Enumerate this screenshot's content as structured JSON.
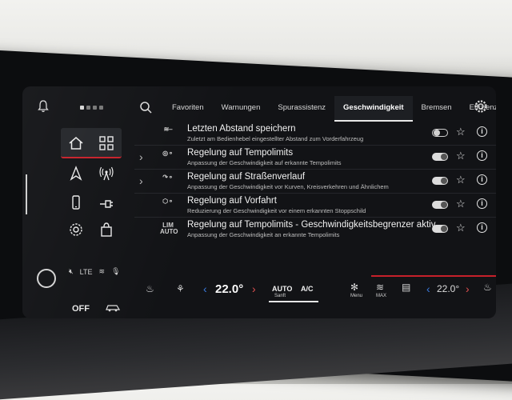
{
  "tabs": [
    {
      "label": "Favoriten"
    },
    {
      "label": "Warnungen"
    },
    {
      "label": "Spurassistenz"
    },
    {
      "label": "Geschwindigkeit"
    },
    {
      "label": "Bremsen"
    },
    {
      "label": "Effizienz"
    }
  ],
  "active_tab": "Geschwindigkeit",
  "rows": [
    {
      "title": "Letzten Abstand speichern",
      "subtitle": "Zuletzt am Bedienhebel eingestellter Abstand zum Vorderfahrzeug",
      "icon": "distance-icon",
      "enabled": false
    },
    {
      "title": "Regelung auf Tempolimits",
      "subtitle": "Anpassung der Geschwindigkeit auf erkannte Tempolimits",
      "icon": "speed-sign-car-icon",
      "enabled": true
    },
    {
      "title": "Regelung auf Straßenverlauf",
      "subtitle": "Anpassung der Geschwindigkeit vor Kurven, Kreisverkehren und Ähnlichem",
      "icon": "curve-car-icon",
      "enabled": true
    },
    {
      "title": "Regelung auf Vorfahrt",
      "subtitle": "Reduzierung der Geschwindigkeit vor einem erkannten Stoppschild",
      "icon": "stop-car-icon",
      "enabled": true
    },
    {
      "title": "Regelung auf Tempolimits - Geschwindigkeitsbegrenzer aktiv",
      "subtitle": "Anpassung der Geschwindigkeit an erkannte Tempolimits",
      "icon": "lim-auto-icon",
      "icon_text": "LIM AUTO",
      "enabled": true
    }
  ],
  "climate": {
    "off_label": "OFF",
    "temp_left": "22.0°",
    "auto_label": "AUTO",
    "auto_sub": "Sanft",
    "ac_label": "A/C",
    "menu_label": "Menu",
    "max_label": "MAX",
    "temp_right": "22.0°"
  },
  "status_icons": [
    "mute-icon",
    "lte-signal-icon",
    "seat-heat-icon",
    "microphone-icon"
  ],
  "colors": {
    "accent_red": "#c7202a",
    "arrow_blue": "#3a7be0",
    "screen_bg": "#121316"
  }
}
